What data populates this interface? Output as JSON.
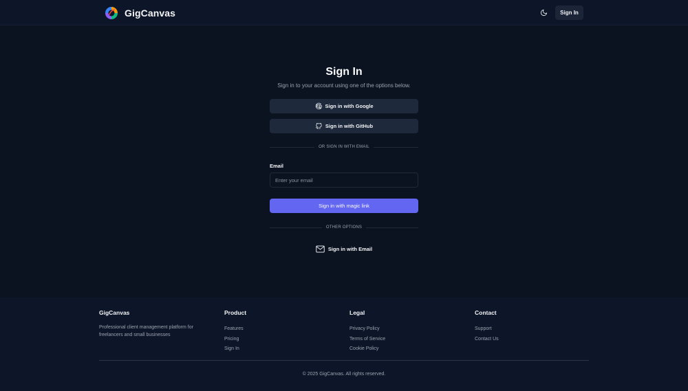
{
  "header": {
    "brand_name": "GigCanvas",
    "sign_in_label": "Sign In",
    "theme_icon": "moon-icon"
  },
  "auth": {
    "title": "Sign In",
    "subtitle": "Sign in to your account using one of the options below.",
    "google_label": "Sign in with Google",
    "github_label": "Sign in with GitHub",
    "divider_email": "OR SIGN IN WITH EMAIL",
    "email_label": "Email",
    "email_placeholder": "Enter your email",
    "email_value": "",
    "magic_link_label": "Sign in with magic link",
    "divider_other": "OTHER OPTIONS",
    "email_option_label": "Sign in with Email",
    "accent_color": "#6366f1"
  },
  "footer": {
    "brand": "GigCanvas",
    "description": "Professional client management platform for freelancers and small businesses",
    "product": {
      "heading": "Product",
      "links": [
        "Features",
        "Pricing",
        "Sign In"
      ]
    },
    "legal": {
      "heading": "Legal",
      "links": [
        "Privacy Policy",
        "Terms of Service",
        "Cookie Policy"
      ]
    },
    "contact": {
      "heading": "Contact",
      "links": [
        "Support",
        "Contact Us"
      ]
    },
    "copyright": "© 2025 GigCanvas. All rights reserved."
  }
}
